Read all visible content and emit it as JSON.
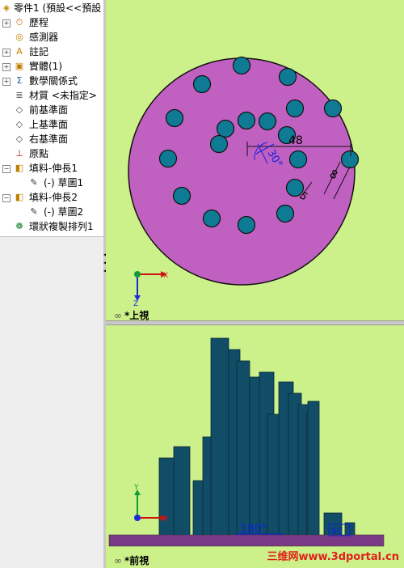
{
  "tree": {
    "root_label": "零件1 (預設<<預設",
    "items": [
      {
        "label": "歷程",
        "icon": "history-icon",
        "glyph": "⏱",
        "expander": "+"
      },
      {
        "label": "感測器",
        "icon": "sensor-icon",
        "glyph": "◎",
        "expander": ""
      },
      {
        "label": "註記",
        "icon": "annotation-icon",
        "glyph": "A",
        "expander": "+"
      },
      {
        "label": "實體(1)",
        "icon": "solid-body-icon",
        "glyph": "▣",
        "expander": "+"
      },
      {
        "label": "數學關係式",
        "icon": "equation-icon",
        "glyph": "Σ",
        "expander": "+"
      },
      {
        "label": "材質 <未指定>",
        "icon": "material-icon",
        "glyph": "≣",
        "expander": ""
      },
      {
        "label": "前基準面",
        "icon": "plane-icon",
        "glyph": "◇",
        "expander": ""
      },
      {
        "label": "上基準面",
        "icon": "plane-icon",
        "glyph": "◇",
        "expander": ""
      },
      {
        "label": "右基準面",
        "icon": "plane-icon",
        "glyph": "◇",
        "expander": ""
      },
      {
        "label": "原點",
        "icon": "origin-icon",
        "glyph": "⊥",
        "expander": ""
      },
      {
        "label": "填料-伸長1",
        "icon": "extrude-icon",
        "glyph": "◧",
        "expander": "−"
      },
      {
        "label": "(-) 草圖1",
        "icon": "sketch-icon",
        "glyph": "✎",
        "expander": "",
        "child": true
      },
      {
        "label": "填料-伸長2",
        "icon": "extrude-icon",
        "glyph": "◧",
        "expander": "−"
      },
      {
        "label": "(-) 草圖2",
        "icon": "sketch-icon",
        "glyph": "✎",
        "expander": "",
        "child": true
      },
      {
        "label": "環狀複製排列1",
        "icon": "circular-pattern-icon",
        "glyph": "❁",
        "expander": ""
      }
    ]
  },
  "views": {
    "top": {
      "label": "*上視",
      "dim_48": "48",
      "dim_30": "30°",
      "dim_8": "8",
      "dim_5": "5"
    },
    "front": {
      "label": "*前視",
      "dim_180": "180°",
      "dim_small": "90"
    }
  },
  "axes": {
    "x": "X",
    "y": "Y",
    "z": "Z"
  },
  "watermark": "三维网www.3dportal.cn",
  "colors": {
    "bg": "#ccf08a",
    "disk": "#c060c0",
    "hole": "#0e7a94",
    "column": "#114d66",
    "base": "#7a3a86"
  }
}
